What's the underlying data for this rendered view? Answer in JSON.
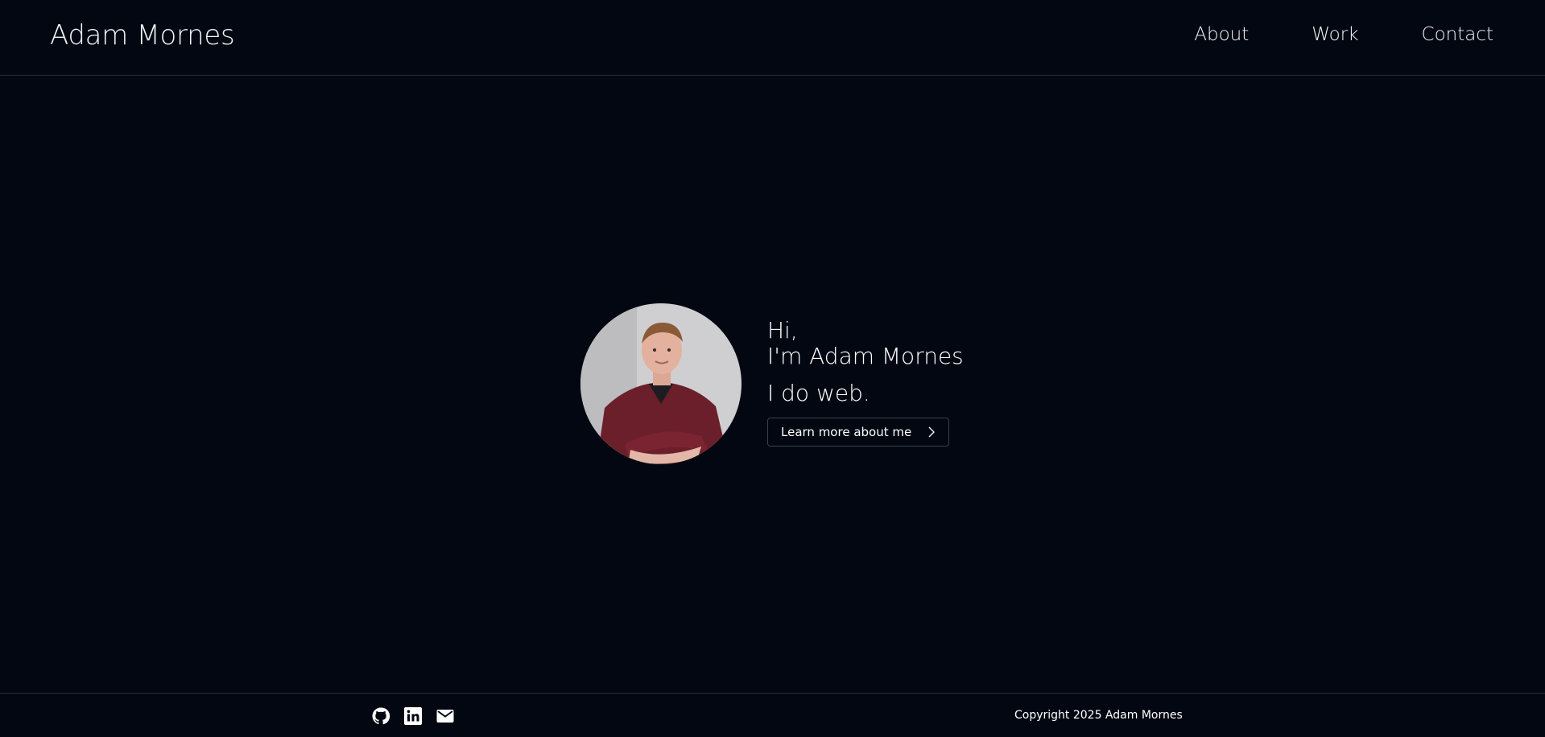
{
  "header": {
    "site_name": "Adam Mornes",
    "nav": [
      "About",
      "Work",
      "Contact"
    ]
  },
  "hero": {
    "greeting": "Hi,",
    "name_line": "I'm Adam Mornes",
    "tagline": "I do web.",
    "cta_label": "Learn more about me",
    "cta_icon": "chevron-right-icon",
    "avatar": "portrait-photo"
  },
  "footer": {
    "social_icons": [
      "github-icon",
      "linkedin-icon",
      "mail-icon"
    ],
    "copyright": "Copyright 2025 Adam Mornes"
  },
  "colors": {
    "background": "#030712",
    "text": "#ffffff",
    "border": "#2a2f3a"
  }
}
